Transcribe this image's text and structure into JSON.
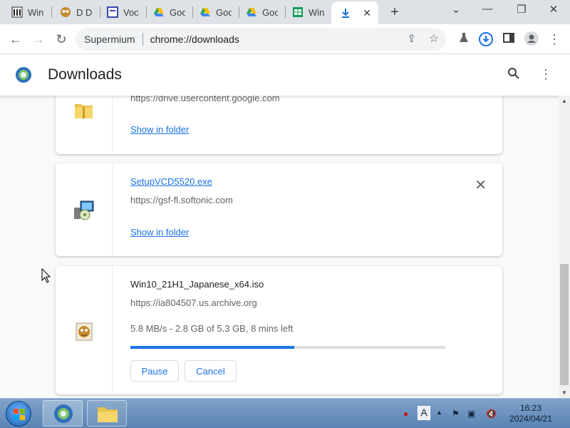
{
  "tabs": [
    {
      "title": "Winc",
      "icon": "columns-icon"
    },
    {
      "title": "D Do",
      "icon": "owl-icon"
    },
    {
      "title": "Voca",
      "icon": "doc-icon"
    },
    {
      "title": "Goo",
      "icon": "google-drive-icon"
    },
    {
      "title": "Goo",
      "icon": "google-drive-icon"
    },
    {
      "title": "Goo",
      "icon": "google-drive-icon"
    },
    {
      "title": "Winc",
      "icon": "spreadsheet-icon"
    }
  ],
  "active_tab": {
    "title": "",
    "icon": "download-icon"
  },
  "omnibox": {
    "site": "Supermium",
    "url": "chrome://downloads"
  },
  "page": {
    "title": "Downloads"
  },
  "downloads": [
    {
      "url": "https://drive.usercontent.google.com",
      "action": "Show in folder",
      "icon": "zip-folder-icon"
    },
    {
      "name": "SetupVCD5520.exe",
      "url": "https://gsf-fl.softonic.com",
      "action": "Show in folder",
      "icon": "installer-icon"
    },
    {
      "name": "Win10_21H1_Japanese_x64.iso",
      "url": "https://ia804507.us.archive.org",
      "status": "5.8 MB/s - 2.8 GB of 5.3 GB, 8 mins left",
      "progress": 0.52,
      "pause_label": "Pause",
      "cancel_label": "Cancel",
      "icon": "disc-image-icon"
    }
  ],
  "taskbar": {
    "time": "16:23",
    "date": "2024/04/21",
    "ime": "A"
  },
  "colors": {
    "accent": "#1a73e8",
    "tabstrip": "#dee1e6"
  }
}
